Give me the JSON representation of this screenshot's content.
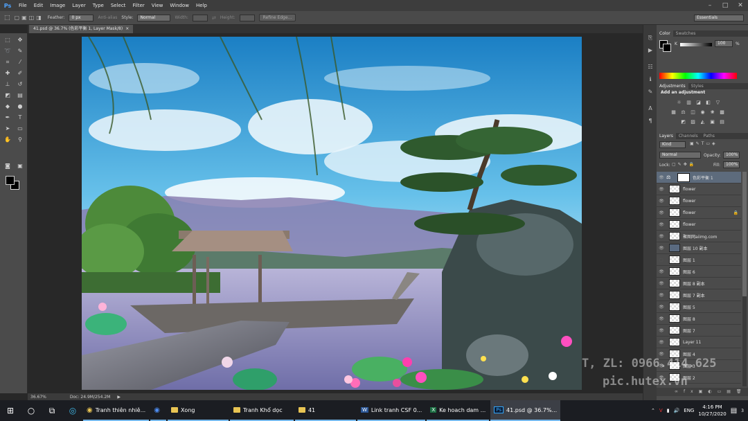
{
  "app": {
    "logo": "Ps"
  },
  "menu": [
    "File",
    "Edit",
    "Image",
    "Layer",
    "Type",
    "Select",
    "Filter",
    "View",
    "Window",
    "Help"
  ],
  "window_controls": {
    "min": "–",
    "max": "□",
    "close": "✕"
  },
  "options": {
    "feather_label": "Feather:",
    "feather_value": "0 px",
    "antialias_label": "Anti-alias",
    "style_label": "Style:",
    "style_value": "Normal",
    "width_label": "Width:",
    "height_label": "Height:",
    "refine_edge": "Refine Edge...",
    "workspace": "Essentials"
  },
  "document": {
    "tab_title": "41.psd @ 36.7% (色彩平衡 1, Layer Mask/8)",
    "tab_close": "×",
    "zoom": "36.67%",
    "doc_size": "Doc: 24.9M/254.2M"
  },
  "color_panel": {
    "tabs": [
      "Color",
      "Swatches"
    ],
    "channel": "K",
    "value": "100",
    "unit": "%"
  },
  "adjustments": {
    "tabs": [
      "Adjustments",
      "Styles"
    ],
    "heading": "Add an adjustment"
  },
  "layers_panel": {
    "tabs": [
      "Layers",
      "Channels",
      "Paths"
    ],
    "filter": "Kind",
    "blend_mode": "Normal",
    "opacity_label": "Opacity:",
    "opacity_value": "100%",
    "lock_label": "Lock:",
    "fill_label": "Fill:",
    "fill_value": "100%",
    "layers": [
      {
        "name": "色彩平衡 1"
      },
      {
        "name": "flower"
      },
      {
        "name": "flower"
      },
      {
        "name": "flower"
      },
      {
        "name": "flower"
      },
      {
        "name": "聚图网aiimg.com"
      },
      {
        "name": "图层 10 副本"
      },
      {
        "name": "图层 1"
      },
      {
        "name": "图层 6"
      },
      {
        "name": "图层 8 副本"
      },
      {
        "name": "图层 7 副本"
      },
      {
        "name": "图层 5"
      },
      {
        "name": "图层 8"
      },
      {
        "name": "图层 7"
      },
      {
        "name": "Layer 11"
      },
      {
        "name": "图层 4"
      },
      {
        "name": "图层 3"
      },
      {
        "name": "图层 2"
      }
    ]
  },
  "watermark": {
    "line1": "T, ZL: 0966.414.625",
    "line2": "pic.hutex.vn"
  },
  "taskbar": {
    "apps": [
      {
        "label": "Tranh thiên nhiê..."
      },
      {
        "label": ""
      },
      {
        "label": "Xong"
      },
      {
        "label": "Tranh Khổ dọc"
      },
      {
        "label": "41"
      },
      {
        "label": "Link tranh CSF 0..."
      },
      {
        "label": "Ke hoach dam ..."
      },
      {
        "label": "41.psd @ 36.7%..."
      }
    ],
    "lang": "ENG",
    "time": "4:16 PM",
    "date": "10/27/2020",
    "notifications": "3"
  }
}
